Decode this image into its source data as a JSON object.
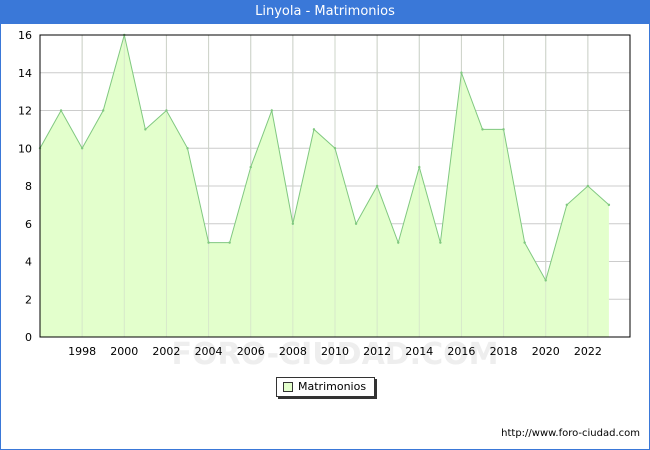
{
  "window": {
    "title": "Linyola - Matrimonios"
  },
  "watermark": "FORO-CIUDAD.COM",
  "source": {
    "text": "http://www.foro-ciudad.com"
  },
  "colors": {
    "title_bar": "#3a78d8",
    "fill": "#e3ffcc",
    "line": "#80c880",
    "grid": "#cccccc"
  },
  "chart_data": {
    "type": "area",
    "title": "Linyola - Matrimonios",
    "xlabel": "",
    "ylabel": "",
    "x": [
      1996,
      1997,
      1998,
      1999,
      2000,
      2001,
      2002,
      2003,
      2004,
      2005,
      2006,
      2007,
      2008,
      2009,
      2010,
      2011,
      2012,
      2013,
      2014,
      2015,
      2016,
      2017,
      2018,
      2019,
      2020,
      2021,
      2022,
      2023
    ],
    "series": [
      {
        "name": "Matrimonios",
        "values": [
          10,
          12,
          10,
          12,
          16,
          11,
          12,
          10,
          5,
          5,
          9,
          12,
          6,
          11,
          10,
          6,
          8,
          5,
          9,
          5,
          14,
          11,
          11,
          5,
          3,
          7,
          8,
          7
        ]
      }
    ],
    "x_ticks": [
      1998,
      2000,
      2002,
      2004,
      2006,
      2008,
      2010,
      2012,
      2014,
      2016,
      2018,
      2020,
      2022
    ],
    "y_ticks": [
      0,
      2,
      4,
      6,
      8,
      10,
      12,
      14,
      16
    ],
    "ylim": [
      0,
      16
    ],
    "grid": true,
    "legend": "bottom-center"
  }
}
